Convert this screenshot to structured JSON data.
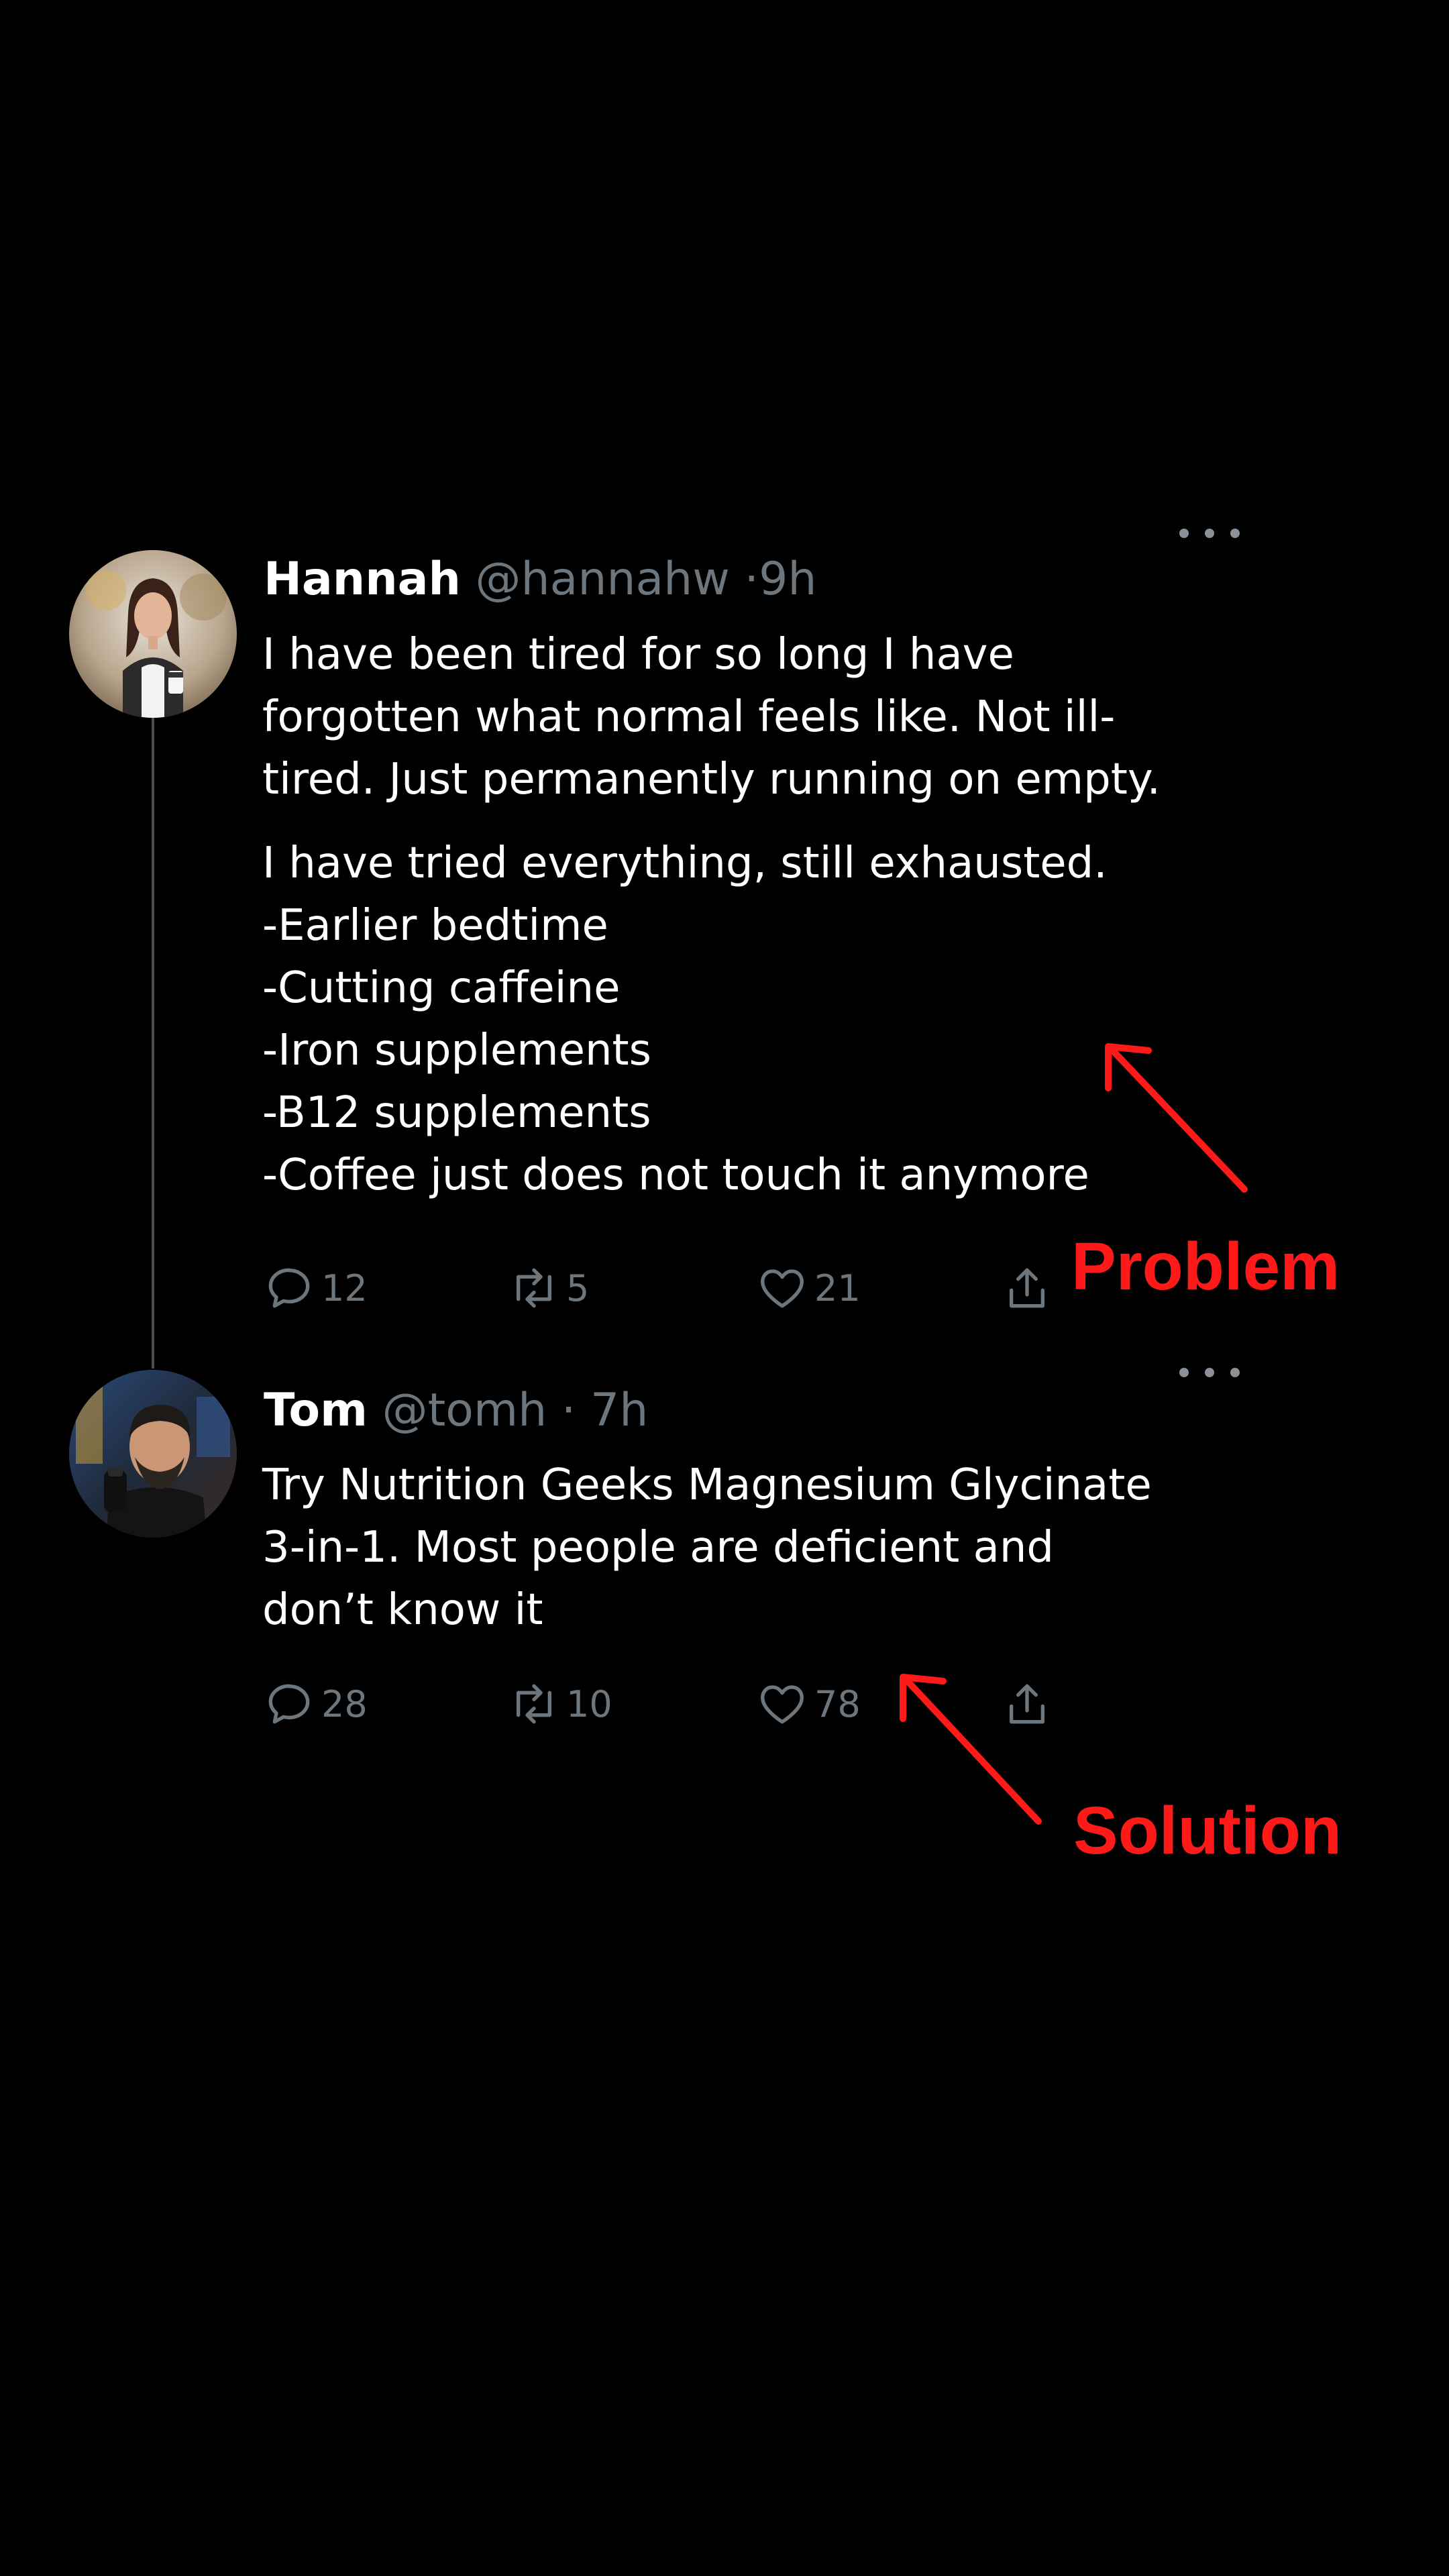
{
  "thread": {
    "tweets": [
      {
        "display_name": "Hannah",
        "handle": "@hannahw",
        "meta": "·9h",
        "avatar_icon": "woman-avatar",
        "body_paragraphs": [
          "I have been tired for so long I have\nforgotten what normal feels like. Not ill-\ntired. Just permanently running on empty.",
          "I have tried everything, still exhausted.\n-Earlier bedtime\n-Cutting caffeine\n-Iron supplements\n-B12 supplements\n-Coffee just does not touch it anymore"
        ],
        "actions": {
          "reply_count": "12",
          "retweet_count": "5",
          "like_count": "21"
        }
      },
      {
        "display_name": "Tom",
        "handle": "@tomh",
        "meta": "· 7h",
        "avatar_icon": "man-avatar",
        "body_paragraphs": [
          "Try Nutrition Geeks Magnesium Glycinate\n3-in-1. Most people are deficient and\ndon’t know it"
        ],
        "actions": {
          "reply_count": "28",
          "retweet_count": "10",
          "like_count": "78"
        }
      }
    ]
  },
  "annotations": {
    "problem_label": "Problem",
    "solution_label": "Solution",
    "color": "#ff1a1a"
  },
  "colors": {
    "background": "#000000",
    "text": "#ffffff",
    "muted": "#6e767d",
    "thread_line": "#4a4f55"
  }
}
